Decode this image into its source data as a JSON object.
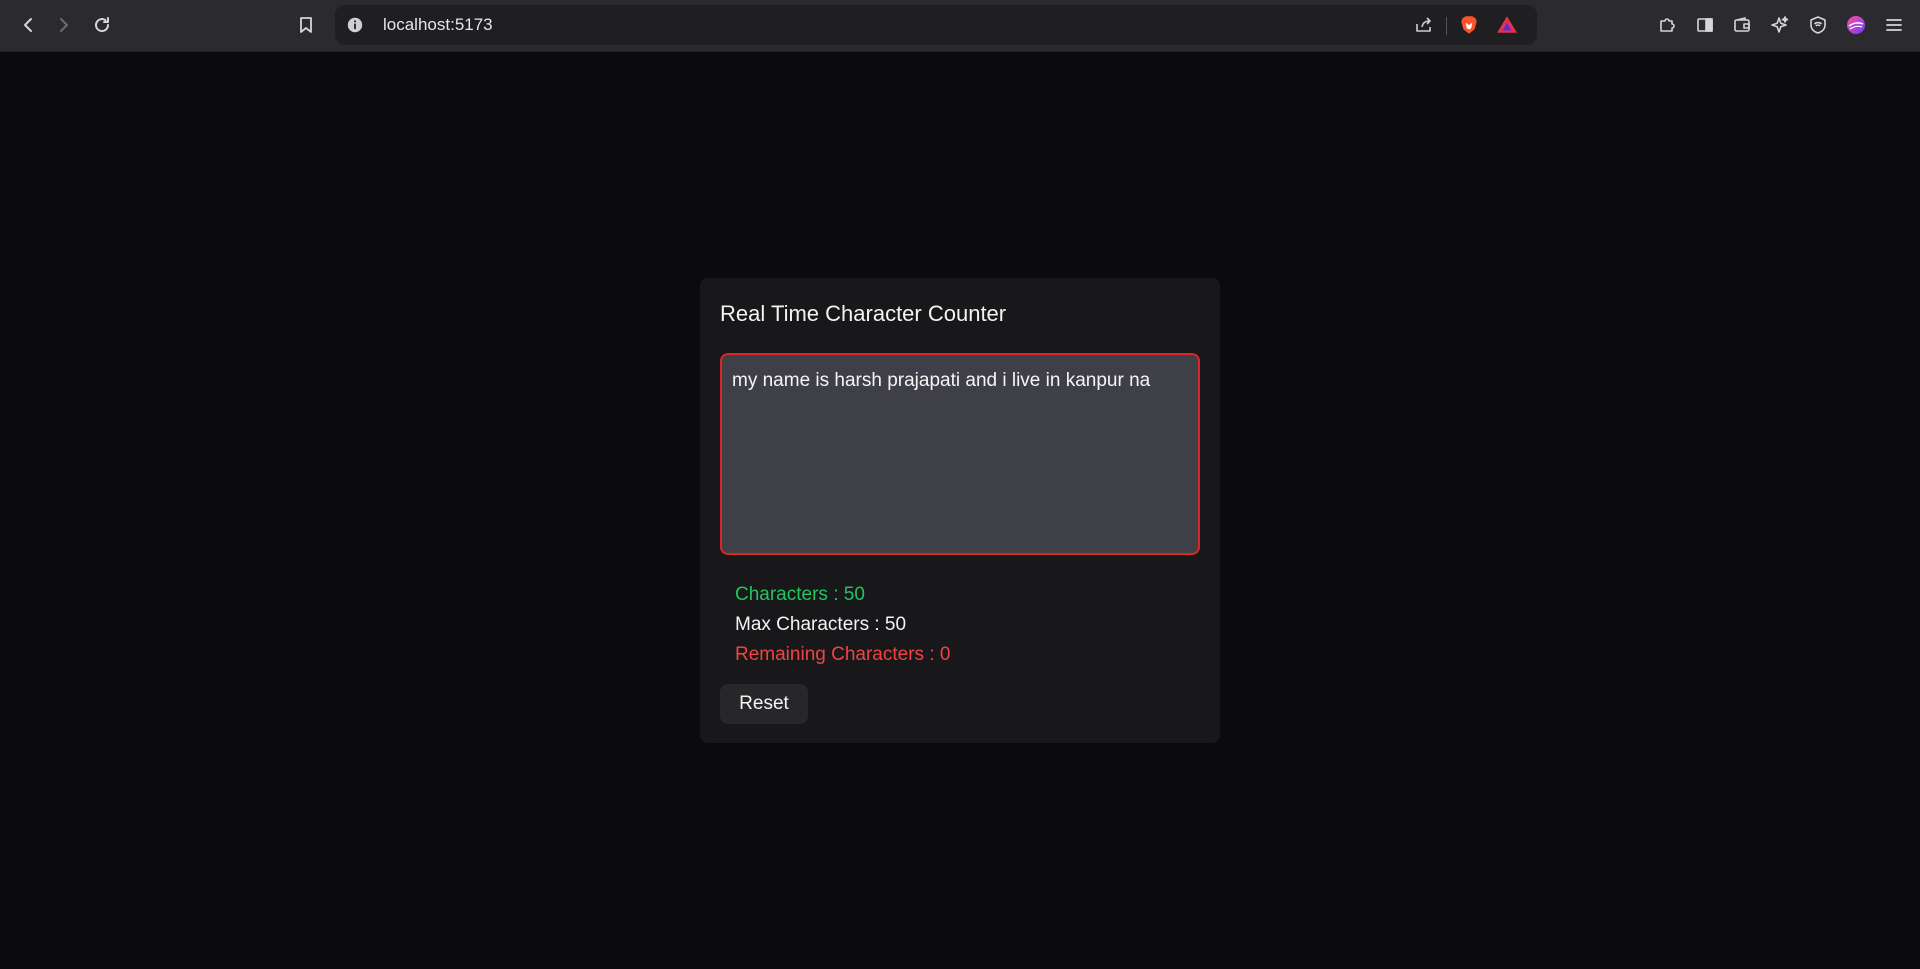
{
  "browser": {
    "url": "localhost:5173",
    "icons": [
      "back-icon",
      "forward-icon",
      "reload-icon",
      "bookmark-icon",
      "site-info-icon",
      "share-icon",
      "brave-shields-icon",
      "brave-rewards-icon",
      "extensions-icon",
      "sidebar-icon",
      "wallet-icon",
      "leo-ai-icon",
      "vpn-icon",
      "profile-avatar",
      "menu-icon"
    ]
  },
  "app": {
    "title": "Real Time Character Counter",
    "textarea_value": "my name is harsh prajapati and i live in kanpur na",
    "characters_text": "Characters : 50",
    "max_characters_text": "Max Characters : 50",
    "remaining_text": "Remaining Characters : 0",
    "reset_label": "Reset"
  },
  "colors": {
    "page_bg": "#0b0b0d",
    "card_bg": "#18181b",
    "textarea_bg": "#3f3f47",
    "error_border": "#dc2626",
    "characters_color": "#22c55e",
    "remaining_color": "#ef4444"
  }
}
